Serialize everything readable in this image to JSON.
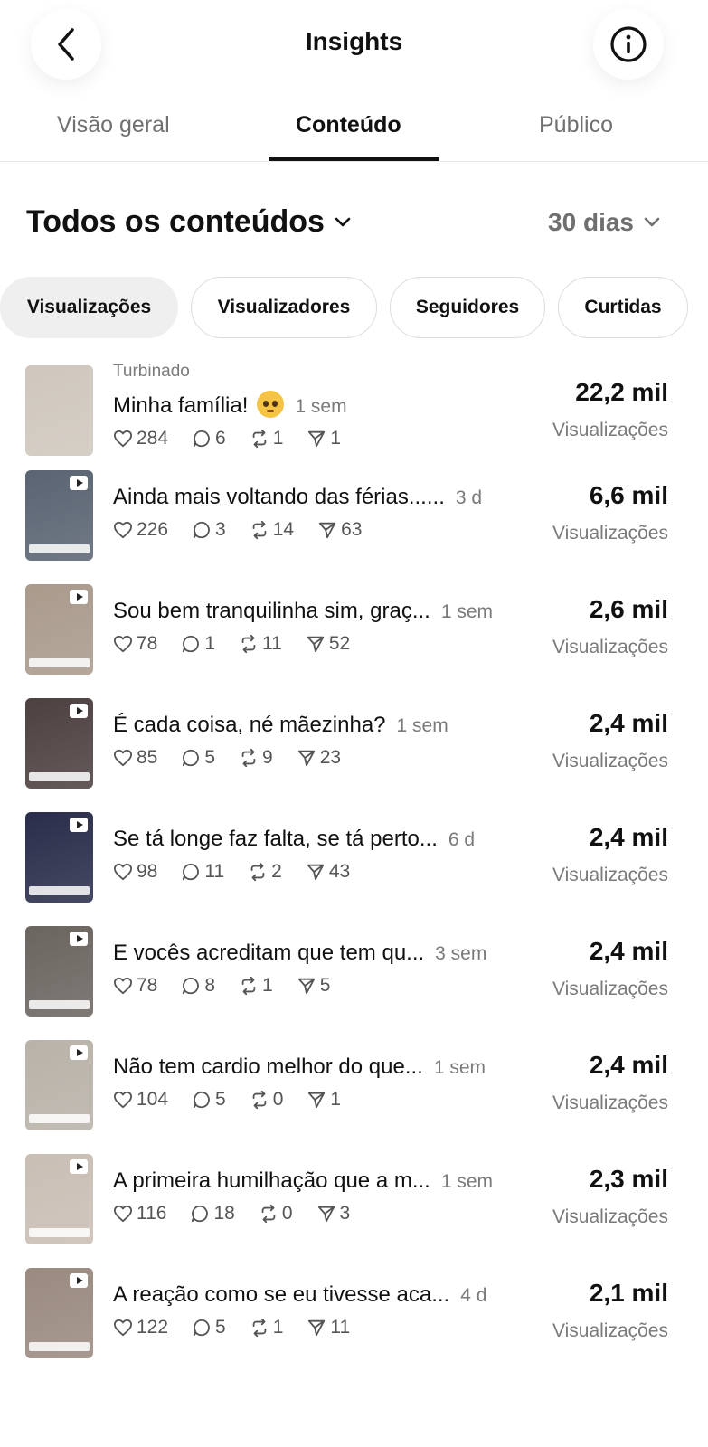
{
  "header": {
    "title": "Insights",
    "back_icon": "chevron-left-icon",
    "info_icon": "info-circle-icon"
  },
  "tabs": [
    {
      "label": "Visão geral",
      "active": false
    },
    {
      "label": "Conteúdo",
      "active": true
    },
    {
      "label": "Público",
      "active": false
    }
  ],
  "filter": {
    "content_label": "Todos os conteúdos",
    "period_label": "30 dias"
  },
  "chips": [
    {
      "label": "Visualizações",
      "active": true
    },
    {
      "label": "Visualizadores",
      "active": false
    },
    {
      "label": "Seguidores",
      "active": false
    },
    {
      "label": "Curtidas",
      "active": false
    }
  ],
  "posts": [
    {
      "badge": "Turbinado",
      "title": "Minha família!",
      "emoji": "pleading-face-emoji",
      "age": "1 sem",
      "likes": "284",
      "comments": "6",
      "reposts": "1",
      "shares": "1",
      "metric": "22,2 mil",
      "metric_label": "Visualizações",
      "thumb_color": "#cfc7bd"
    },
    {
      "badge": "",
      "title": "Ainda mais voltando das férias......",
      "age": "3 d",
      "likes": "226",
      "comments": "3",
      "reposts": "14",
      "shares": "63",
      "metric": "6,6 mil",
      "metric_label": "Visualizações",
      "thumb_color": "#5a6472"
    },
    {
      "badge": "",
      "title": "Sou bem tranquilinha sim, graç...",
      "age": "1 sem",
      "likes": "78",
      "comments": "1",
      "reposts": "11",
      "shares": "52",
      "metric": "2,6 mil",
      "metric_label": "Visualizações",
      "thumb_color": "#a99a8c"
    },
    {
      "badge": "",
      "title": "É cada coisa, né mãezinha?",
      "age": "1 sem",
      "likes": "85",
      "comments": "5",
      "reposts": "9",
      "shares": "23",
      "metric": "2,4 mil",
      "metric_label": "Visualizações",
      "thumb_color": "#4d4040"
    },
    {
      "badge": "",
      "title": "Se tá longe faz falta, se tá perto...",
      "age": "6 d",
      "likes": "98",
      "comments": "11",
      "reposts": "2",
      "shares": "43",
      "metric": "2,4 mil",
      "metric_label": "Visualizações",
      "thumb_color": "#2a2d4a"
    },
    {
      "badge": "",
      "title": "E vocês acreditam que tem qu...",
      "age": "3 sem",
      "likes": "78",
      "comments": "8",
      "reposts": "1",
      "shares": "5",
      "metric": "2,4 mil",
      "metric_label": "Visualizações",
      "thumb_color": "#6b6560"
    },
    {
      "badge": "",
      "title": "Não tem cardio melhor do que...",
      "age": "1 sem",
      "likes": "104",
      "comments": "5",
      "reposts": "0",
      "shares": "1",
      "metric": "2,4 mil",
      "metric_label": "Visualizações",
      "thumb_color": "#b8b2a8"
    },
    {
      "badge": "",
      "title": "A primeira humilhação que a m...",
      "age": "1 sem",
      "likes": "116",
      "comments": "18",
      "reposts": "0",
      "shares": "3",
      "metric": "2,3 mil",
      "metric_label": "Visualizações",
      "thumb_color": "#c9beb4"
    },
    {
      "badge": "",
      "title": "A reação como se eu tivesse aca...",
      "age": "4 d",
      "likes": "122",
      "comments": "5",
      "reposts": "1",
      "shares": "11",
      "metric": "2,1 mil",
      "metric_label": "Visualizações",
      "thumb_color": "#9a8a80"
    }
  ]
}
